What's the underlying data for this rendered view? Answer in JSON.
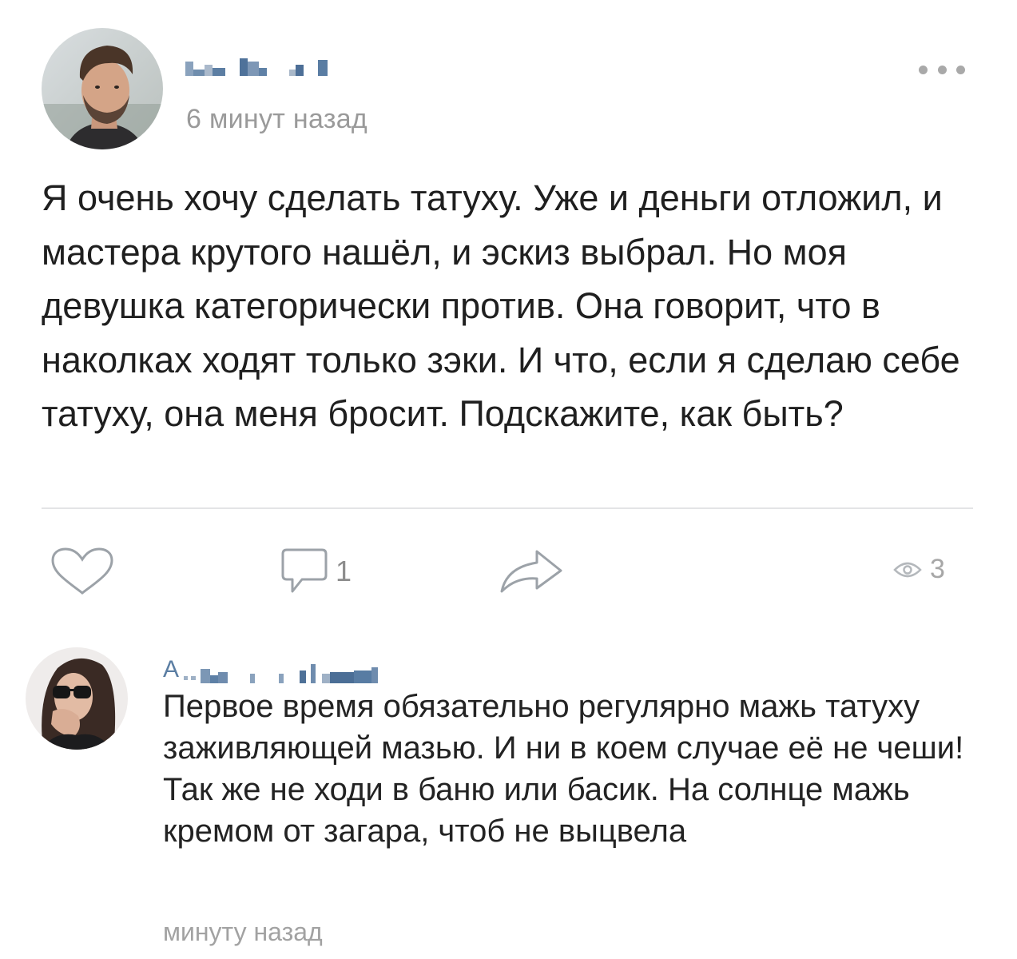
{
  "post": {
    "author_name_pixelated": "",
    "time": "6 минут назад",
    "text": "Я очень хочу сделать татуху. Уже и деньги отложил, и мастера крутого нашёл, и эскиз выбрал. Но моя девушка категорически против. Она говорит, что в наколках ходят только зэки. И что, если я сделаю себе татуху, она меня бросит. Подскажите, как быть?",
    "icons": {
      "more": "more-dots-icon",
      "like": "heart-outline-icon",
      "comment": "comment-bubble-icon",
      "share": "share-arrow-icon",
      "views": "eye-icon"
    }
  },
  "actions": {
    "comments_count": "1",
    "views_count": "3"
  },
  "comment": {
    "author_initial": "А",
    "text": "Первое время обязательно регулярно мажь татуху заживляющей мазью. И ни в коем случае её не чеши! Так же не ходи в баню или басик. На солнце мажь кремом от загара, чтоб не выцвела",
    "time": "минуту назад"
  },
  "colors": {
    "link_blue": "#5b7ea3",
    "icon_gray": "#a9a9a9",
    "meta_gray": "#9a9a9a",
    "text": "#1f1f1f"
  }
}
